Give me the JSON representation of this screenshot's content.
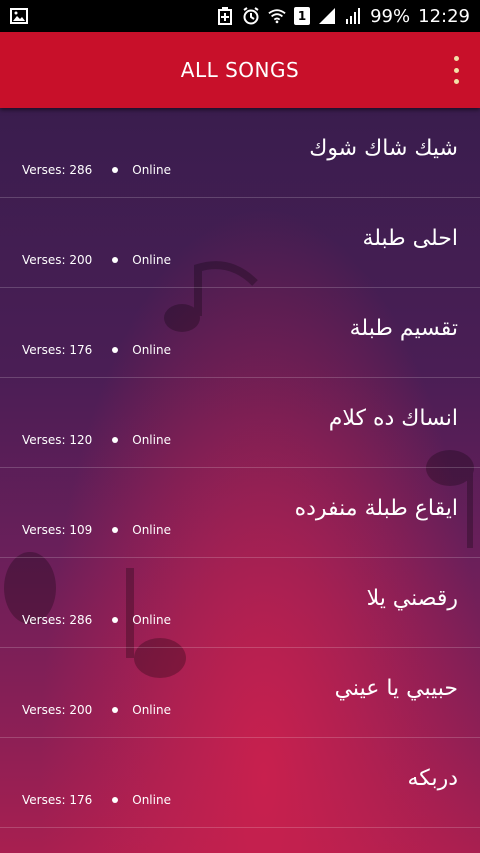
{
  "statusbar": {
    "sim_label": "1",
    "battery": "99%",
    "time": "12:29"
  },
  "appbar": {
    "title": "ALL SONGS"
  },
  "meta_labels": {
    "verses_prefix": "Verses:",
    "online": "Online"
  },
  "songs": [
    {
      "title": "شيك شاك شوك",
      "verses": "Verses: 286",
      "status": "Online"
    },
    {
      "title": "احلى طبلة",
      "verses": "Verses: 200",
      "status": "Online"
    },
    {
      "title": "تقسيم طبلة",
      "verses": "Verses: 176",
      "status": "Online"
    },
    {
      "title": "انساك ده كلام",
      "verses": "Verses: 120",
      "status": "Online"
    },
    {
      "title": "ايقاع طبلة منفرده",
      "verses": "Verses: 109",
      "status": "Online"
    },
    {
      "title": "رقصني يلا",
      "verses": "Verses: 286",
      "status": "Online"
    },
    {
      "title": "حبيبي يا عيني",
      "verses": "Verses: 200",
      "status": "Online"
    },
    {
      "title": "دربكه",
      "verses": "Verses: 176",
      "status": "Online"
    }
  ],
  "colors": {
    "appbar": "#c8102a",
    "overflow_dots": "#f3e1a8"
  }
}
